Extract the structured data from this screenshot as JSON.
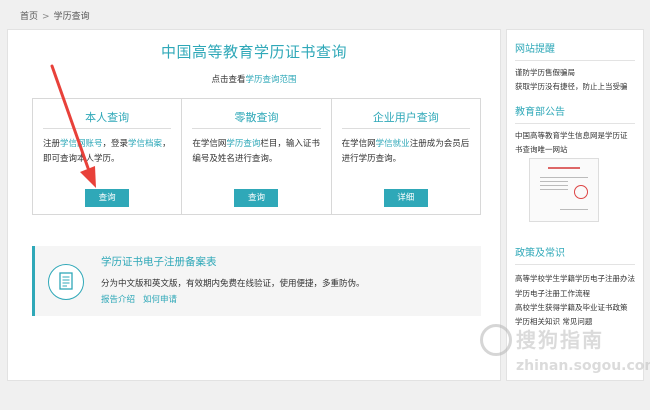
{
  "breadcrumb": {
    "home": "首页",
    "separator": ">",
    "current": "学历查询"
  },
  "main": {
    "title": "中国高等教育学历证书查询",
    "subtitle_prefix": "点击查看",
    "subtitle_link": "学历查询范围"
  },
  "cards": [
    {
      "title": "本人查询",
      "desc_parts": [
        "注册",
        "学信网账号",
        "，登录",
        "学信档案",
        "，即可查询本人学历。"
      ],
      "button": "查询"
    },
    {
      "title": "零散查询",
      "desc_parts": [
        "在学信网",
        "学历查询",
        "栏目，输入证书编号及姓名进行查询。"
      ],
      "button": "查询"
    },
    {
      "title": "企业用户查询",
      "desc_parts": [
        "在学信网",
        "学信就业",
        "注册成为会员后进行学历查询。"
      ],
      "button": "详细"
    }
  ],
  "registration": {
    "title": "学历证书电子注册备案表",
    "desc": "分为中文版和英文版，有效期内免费在线验证，使用便捷，多重防伪。",
    "links": [
      "报告介绍",
      "如何申请"
    ]
  },
  "sidebar": {
    "reminder": {
      "title": "网站提醒",
      "items": [
        "谨防学历售假骗局",
        "获取学历没有捷径，防止上当受骗"
      ]
    },
    "announcement": {
      "title": "教育部公告",
      "items": [
        "中国高等教育学生信息网是学历证",
        "书查询唯一网站"
      ]
    },
    "policy": {
      "title": "政策及常识",
      "items": [
        "高等学校学生学籍学历电子注册办法",
        "学历电子注册工作流程",
        "高校学生获得学籍及毕业证书政策",
        "学历相关知识",
        "常见问题"
      ]
    }
  },
  "watermark": {
    "text": "搜狗指南",
    "url": "zhinan.sogou.com"
  },
  "colors": {
    "accent": "#2fa8b8",
    "arrow": "#e8413a"
  }
}
